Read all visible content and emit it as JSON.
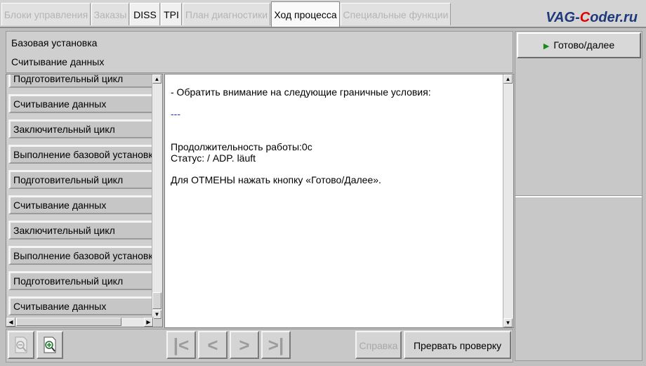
{
  "brand": {
    "prefix": "VAG-",
    "c": "C",
    "suffix": "oder.ru"
  },
  "tabs": [
    {
      "label": "Блоки управления"
    },
    {
      "label": "Заказы"
    },
    {
      "label": "DISS"
    },
    {
      "label": "TPI"
    },
    {
      "label": "План диагностики"
    },
    {
      "label": "Ход процесса"
    },
    {
      "label": "Специальные функции"
    }
  ],
  "header": {
    "line1": "Базовая установка",
    "line2": "Считывание данных"
  },
  "steps": [
    {
      "label": "Подготовительный цикл"
    },
    {
      "label": "Считывание данных"
    },
    {
      "label": "Заключительный цикл"
    },
    {
      "label": "Выполнение базовой установки"
    },
    {
      "label": "Подготовительный цикл"
    },
    {
      "label": "Считывание данных"
    },
    {
      "label": "Заключительный цикл"
    },
    {
      "label": "Выполнение базовой установки"
    },
    {
      "label": "Подготовительный цикл"
    },
    {
      "label": "Считывание данных"
    }
  ],
  "content": {
    "line1": "- Обратить внимание на следующие граничные условия:",
    "line2": "---",
    "line3": "Продолжительность работы:0c",
    "line4": "Статус: / ADP. läuft",
    "line5": "Для ОТМЕНЫ нажать кнопку «Готово/Далее»."
  },
  "right": {
    "done_label": "Готово/далее"
  },
  "bottom": {
    "help_label": "Справка",
    "abort_label": "Прервать проверку"
  },
  "icons": {
    "zoom_out": "zoom-out-icon",
    "zoom_in": "zoom-in-icon",
    "first": "first-page-icon",
    "prev": "prev-page-icon",
    "next": "next-page-icon",
    "last": "last-page-icon",
    "play": "play-icon"
  }
}
